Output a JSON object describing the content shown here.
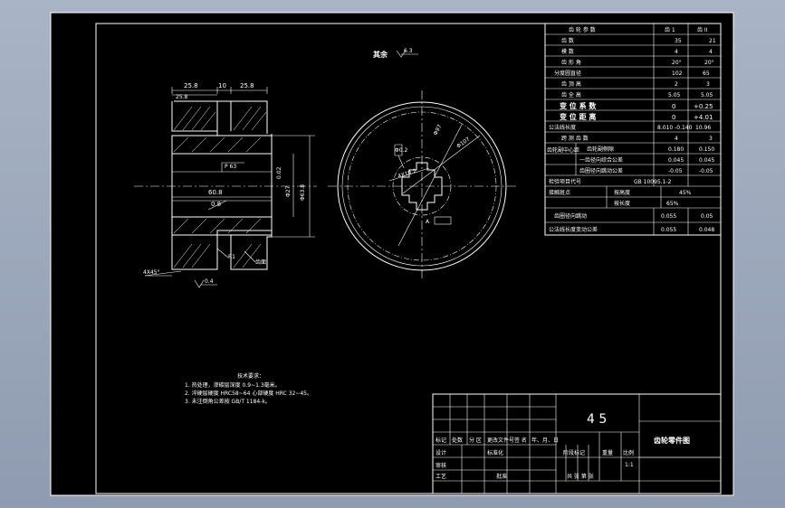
{
  "drawing": {
    "roughness_note": "其余",
    "roughness_value": "6.3",
    "dims": {
      "top1": "25.8",
      "top2": "10",
      "top3": "25.8",
      "left_top": "25.8",
      "chamfer_main": "4X45°",
      "d_inner": "60.8",
      "d_hole": "0.8",
      "tol": "0.02",
      "phi1": "Φ27",
      "phi2": "Φ63.8",
      "roughness_small": "0.4",
      "fillet": "R1",
      "datum": "A",
      "rough1": "6.3",
      "z_label": "齿面",
      "p63": "P 63",
      "r_pitch": "Φ97",
      "r_outer": "Φ107",
      "r_key": "4X10.2",
      "hole_note": "Φ0.2"
    }
  },
  "params": {
    "header": [
      "齿 轮 参 数",
      "齿 1",
      "齿 II"
    ],
    "rows": [
      {
        "label": "齿 数",
        "v1": "35",
        "v2": "21"
      },
      {
        "label": "模 数",
        "v1": "4",
        "v2": "4"
      },
      {
        "label": "齿 形 角",
        "v1": "20°",
        "v2": "20°"
      },
      {
        "label": "分度圆直径",
        "v1": "102",
        "v2": "65"
      },
      {
        "label": "齿 顶 高",
        "v1": "2",
        "v2": "3"
      },
      {
        "label": "齿 全 高",
        "v1": "5.05",
        "v2": "5.05"
      },
      {
        "label": "变 位 系 数",
        "v1": "0",
        "v2": "+0.25"
      },
      {
        "label": "变 位 距 离",
        "v1": "0",
        "v2": "+4.01"
      },
      {
        "label": "公法线长度",
        "v1": "8.010 -0.140",
        "v2": "10.96"
      },
      {
        "label": "跨 测 齿 数",
        "v1": "4",
        "v2": "3"
      },
      {
        "label": "齿轮副侧隙",
        "v1": "0.180",
        "v2": "0.150"
      },
      {
        "label": "一齿径向综合公差",
        "v1": "0.045",
        "v2": "0.045"
      },
      {
        "label": "齿圈径向跳动公差",
        "v1": "-0.05",
        "v2": "-0.05"
      }
    ],
    "group1": "齿轮副中心距",
    "group2": "检验项目代号",
    "standard": "GB 10095.1-2",
    "contact": "接触斑点",
    "contact_h": "按高度",
    "contact_h_val": "45%",
    "contact_l": "按长度",
    "contact_l_val": "65%",
    "radial": "齿圈径向跳动",
    "radial_v1": "0.055",
    "radial_v2": "0.05",
    "norm": "公法线长度变动公差",
    "norm_v1": "0.055",
    "norm_v2": "0.048"
  },
  "notes": {
    "title": "技术要求：",
    "items": [
      "1. 热处理，渗碳层深度 0.9~1.3毫米。",
      "2. 淬硬层硬度 HRC58~64 心部硬度 HRC 32~45。",
      "3. 未注倒角公差按 GB/T 1184-k。"
    ]
  },
  "titleblock": {
    "material": "4 5",
    "name": "齿轮零件图",
    "row_labels": [
      "标记",
      "处数",
      "分 区",
      "更改文件号",
      "签 名",
      "年、月、日"
    ],
    "design": "设计",
    "standardize": "标准化",
    "stage": "阶段标记",
    "weight": "重量",
    "ratio": "比例",
    "scale": "1:1",
    "check": "审核",
    "process": "工艺",
    "approve": "批准",
    "sheets": "共   张   第   张"
  }
}
